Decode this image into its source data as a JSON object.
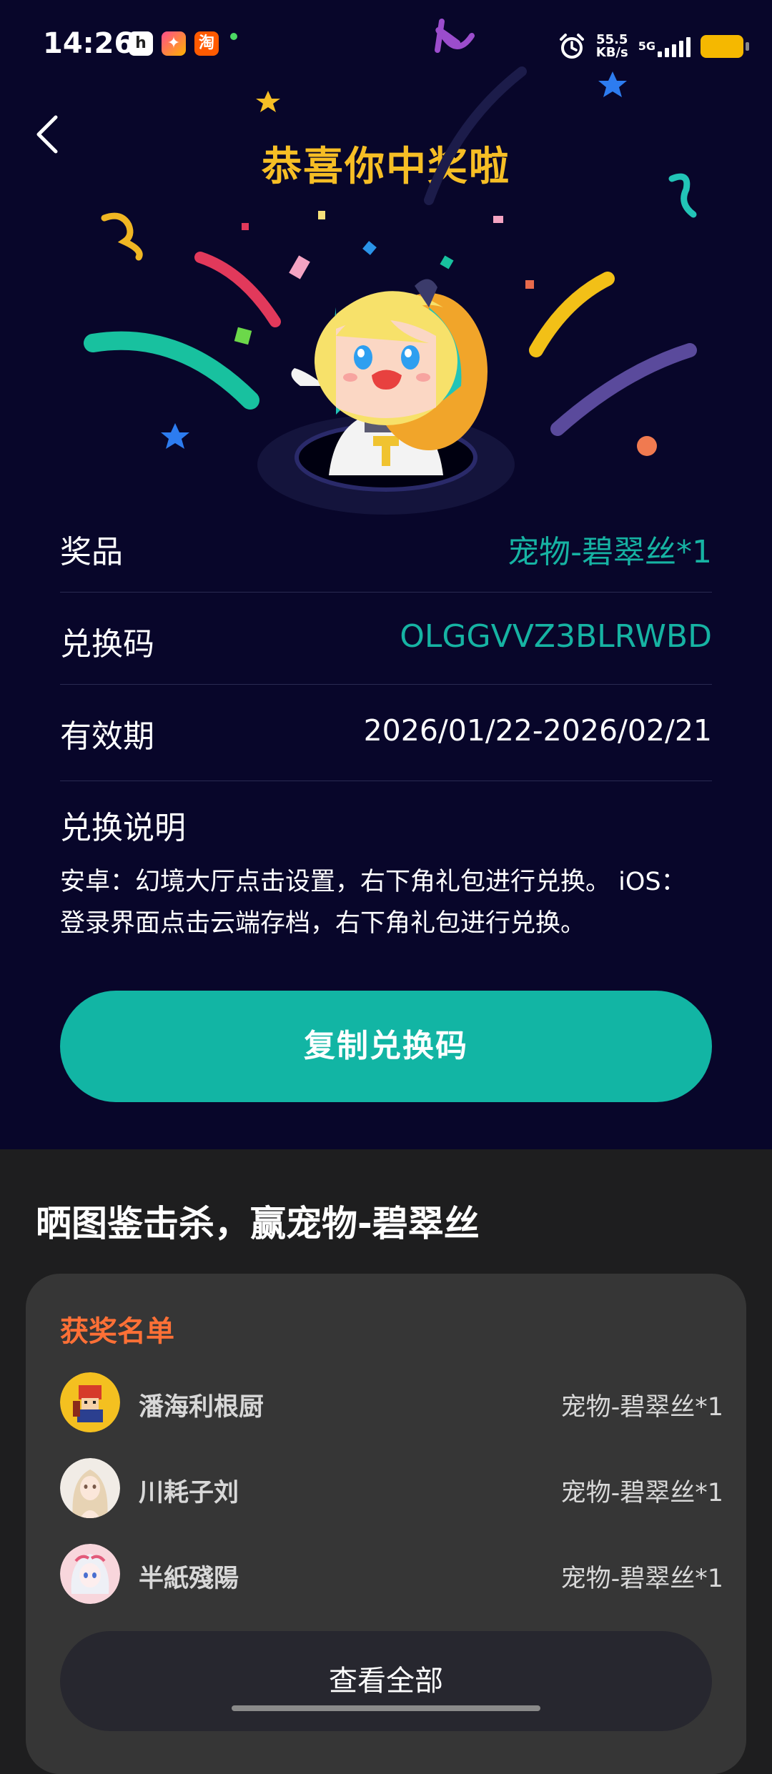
{
  "status_bar": {
    "time": "14:26",
    "apps": [
      "h",
      "✦",
      "淘"
    ],
    "net_speed": "55.5",
    "net_unit": "KB/s",
    "net_type": "5G",
    "battery_color": "#f5b800"
  },
  "header": {
    "title": "恭喜你中奖啦"
  },
  "prize": {
    "rows": [
      {
        "label": "奖品",
        "value": "宠物-碧翠丝*1"
      },
      {
        "label": "兑换码",
        "value": "OLGGVVZ3BLRWBD"
      },
      {
        "label": "有效期",
        "value": "2026/01/22-2026/02/21"
      }
    ],
    "instructions_title": "兑换说明",
    "instructions_line1": "安卓：幻境大厅点击设置，右下角礼包进行兑换。 iOS：",
    "instructions_line2": "登录界面点击云端存档，右下角礼包进行兑换。",
    "copy_button": "复制兑换码"
  },
  "promo": {
    "title": "晒图鉴击杀，赢宠物-碧翠丝",
    "winners_title": "获奖名单",
    "winners": [
      {
        "name": "潘海利根厨",
        "prize": "宠物-碧翠丝*1"
      },
      {
        "name": "川耗子刘",
        "prize": "宠物-碧翠丝*1"
      },
      {
        "name": "半紙殘陽",
        "prize": "宠物-碧翠丝*1"
      }
    ],
    "view_all": "查看全部"
  },
  "colors": {
    "accent_teal": "#12b5a4",
    "title_gold": "#f6be25",
    "winners_orange": "#ff7036",
    "background_navy": "#08062a"
  }
}
